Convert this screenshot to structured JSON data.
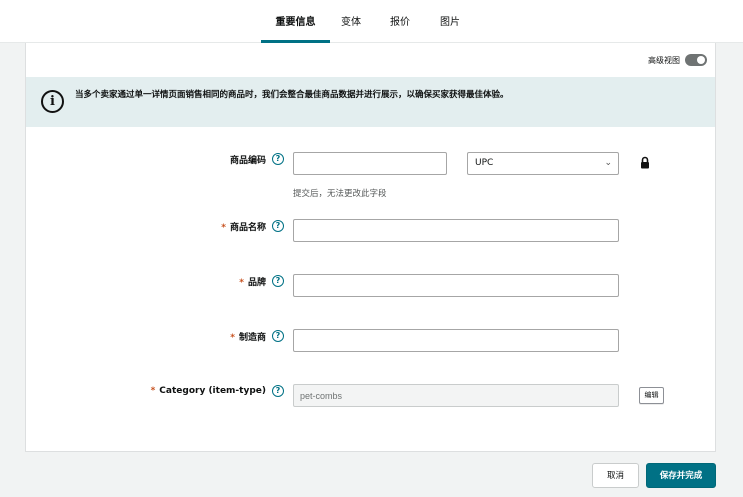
{
  "tabs": [
    {
      "label": "重要信息",
      "active": true
    },
    {
      "label": "变体",
      "active": false
    },
    {
      "label": "报价",
      "active": false
    },
    {
      "label": "图片",
      "active": false
    }
  ],
  "advanced_view_label": "高级视图",
  "banner": {
    "text": "当多个卖家通过单一详情页面销售相同的商品时，我们会整合最佳商品数据并进行展示，以确保买家获得最佳体验。"
  },
  "fields": {
    "product_id": {
      "label": "商品编码",
      "value": "",
      "type_selected": "UPC",
      "hint": "提交后，无法更改此字段"
    },
    "product_name": {
      "label": "商品名称",
      "required": "*",
      "value": ""
    },
    "brand": {
      "label": "品牌",
      "required": "*",
      "value": ""
    },
    "manufacturer": {
      "label": "制造商",
      "required": "*",
      "value": ""
    },
    "category": {
      "label": "Category (item-type)",
      "required": "*",
      "value": "pet-combs",
      "edit_label": "编辑"
    }
  },
  "footer": {
    "cancel_label": "取消",
    "save_label": "保存并完成"
  },
  "colors": {
    "accent": "#007185",
    "banner_bg": "#e3eeef",
    "required": "#c7511f"
  }
}
